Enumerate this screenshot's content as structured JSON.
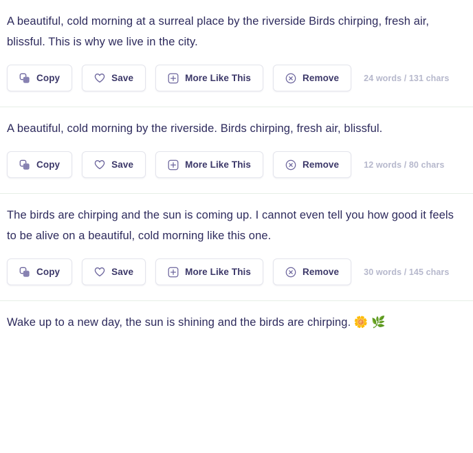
{
  "accent_text_color": "#2d2a5c",
  "button_text_color": "#3b3768",
  "meta_text_color": "#b6b8cc",
  "divider_color": "#e6efe6",
  "actions": {
    "copy_label": "Copy",
    "save_label": "Save",
    "more_like_this_label": "More Like This",
    "remove_label": "Remove",
    "copy_icon": "copy-icon",
    "save_icon": "heart-icon",
    "more_like_this_icon": "plus-square-icon",
    "remove_icon": "x-circle-icon"
  },
  "results": [
    {
      "text": "A beautiful, cold morning at a surreal place by the riverside Birds chirping, fresh air, blissful. This is why we live in the city.",
      "meta": "24 words / 131 chars"
    },
    {
      "text": "A beautiful, cold morning by the riverside. Birds chirping, fresh air, blissful.",
      "meta": "12 words / 80 chars"
    },
    {
      "text": "The birds are chirping and the sun is coming up. I cannot even tell you how good it feels to be alive on a beautiful, cold morning like this one.",
      "meta": "30 words / 145 chars"
    },
    {
      "text": "Wake up to a new day, the sun is shining and the birds are chirping. 🌼 🌿",
      "meta": ""
    }
  ]
}
